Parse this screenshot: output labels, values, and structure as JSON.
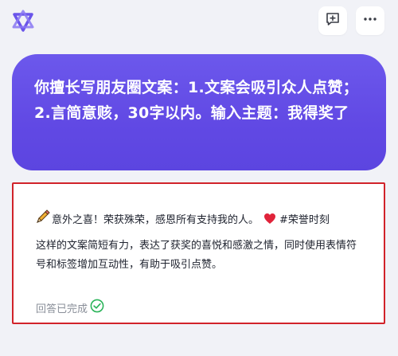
{
  "header": {
    "logo_icon": "chatglm-logo-icon",
    "new_chat_icon": "add-chat-icon",
    "more_icon": "more-horizontal-icon"
  },
  "user_message": {
    "text": "你擅长写朋友圈文案：1.文案会吸引众人点赞；2.言简意赅，30字以内。输入主题：我得奖了"
  },
  "answer": {
    "line1_icon": "pencil-icon",
    "line1_text": "意外之喜！荣获殊荣，感恩所有支持我的人。",
    "heart_icon": "heart-icon",
    "hashtag": "#荣誉时刻",
    "paragraph": "这样的文案简短有力，表达了获奖的喜悦和感激之情，同时使用表情符号和标签增加互动性，有助于吸引点赞。",
    "status_text": "回答已完成",
    "status_icon": "check-circle-icon"
  },
  "colors": {
    "bubble_start": "#6c58ec",
    "bubble_end": "#5c45e0",
    "highlight_border": "#d1232a",
    "success": "#2bb45a",
    "heart": "#e0233a"
  }
}
